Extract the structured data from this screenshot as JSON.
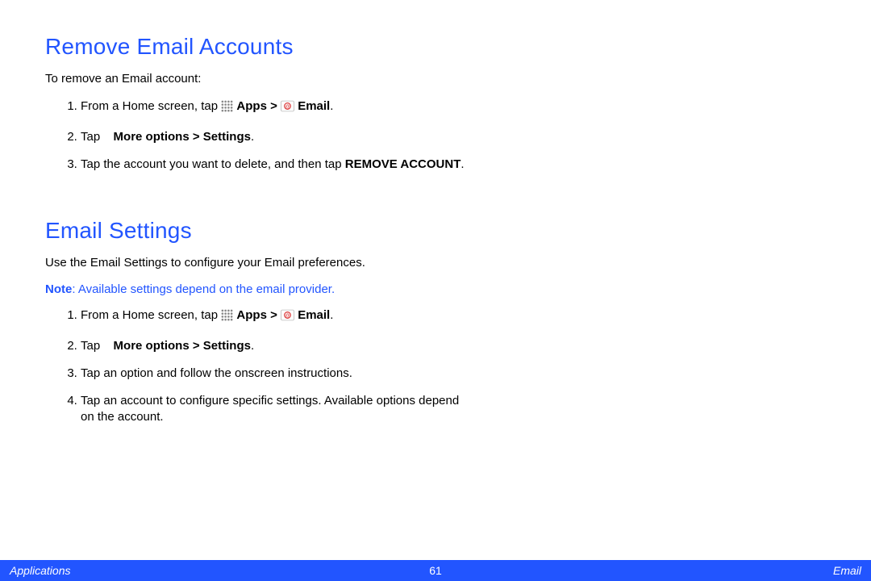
{
  "section1": {
    "heading": "Remove Email Accounts",
    "intro": "To remove an Email account:",
    "steps": {
      "s1_pre": "From a Home screen, tap ",
      "s1_apps": "Apps > ",
      "s1_email": " Email",
      "s2_pre": "Tap ",
      "s2_rest": " More options > Settings",
      "s3_pre": "Tap the account you want to delete, and then tap ",
      "s3_action": "REMOVE ACCOUNT"
    }
  },
  "section2": {
    "heading": "Email Settings",
    "intro": "Use the Email Settings to configure your Email preferences.",
    "note_label": "Note",
    "note_text": ": Available settings depend on the email provider.",
    "steps": {
      "s1_pre": "From a Home screen, tap ",
      "s1_apps": "Apps > ",
      "s1_email": " Email",
      "s2_pre": "Tap ",
      "s2_rest": " More options > Settings",
      "s3": "Tap an option and follow the onscreen instructions.",
      "s4": "Tap an account to configure specific settings. Available options depend on the account."
    }
  },
  "footer": {
    "left": "Applications",
    "center": "61",
    "right": "Email"
  },
  "punct": {
    "period": "."
  }
}
